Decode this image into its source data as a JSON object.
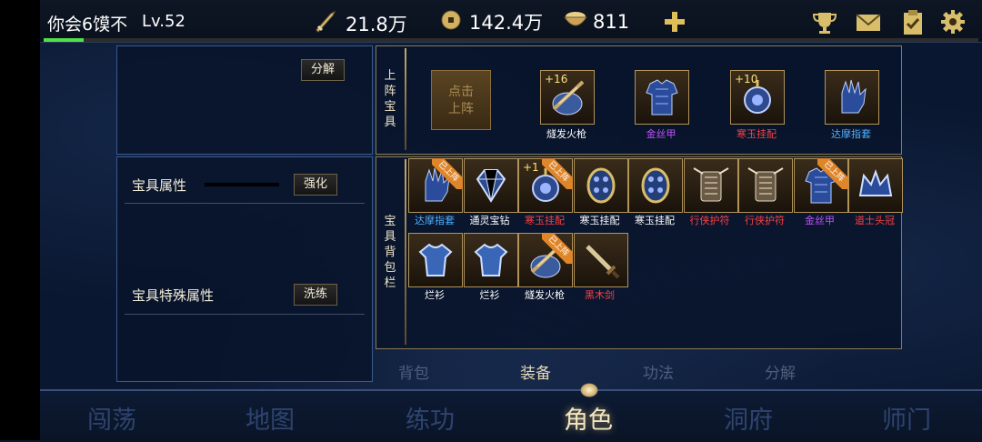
{
  "player": {
    "name": "你会6馍不",
    "level": "Lv.52"
  },
  "resources": {
    "power": "21.8万",
    "coins": "142.4万",
    "food": "811"
  },
  "colors": {
    "xp": "#4fe04a",
    "gold": "#c9a86a",
    "red_item": "#ff4040",
    "blue_item": "#4fb0ff",
    "purple_item": "#c050ff",
    "white_item": "#ffffff"
  },
  "left_top": {
    "decompose_button": "分解"
  },
  "left_bottom": {
    "attr_label": "宝具属性",
    "enhance_button": "强化",
    "special_label": "宝具特殊属性",
    "refine_button": "洗练"
  },
  "equipped": {
    "vertical_label": [
      "上",
      "阵",
      "宝",
      "具"
    ],
    "empty_slot": [
      "点击",
      "上阵"
    ],
    "items": [
      {
        "name": "燧发火枪",
        "plus": "+16",
        "color": "#ffffff",
        "icon": "musket-icon"
      },
      {
        "name": "金丝甲",
        "plus": "",
        "color": "#c050ff",
        "icon": "armor-icon"
      },
      {
        "name": "寒玉挂配",
        "plus": "+10",
        "color": "#ff4040",
        "icon": "pendant-icon"
      },
      {
        "name": "达摩指套",
        "plus": "",
        "color": "#4fb0ff",
        "icon": "glove-icon"
      }
    ]
  },
  "bag": {
    "vertical_label": [
      "宝",
      "具",
      "背",
      "包",
      "栏"
    ],
    "equipped_tag": "已上阵",
    "items": [
      {
        "name": "达摩指套",
        "color": "#4fb0ff",
        "equipped": true,
        "plus": "",
        "icon": "glove-icon"
      },
      {
        "name": "通灵宝钻",
        "color": "#ffffff",
        "equipped": false,
        "plus": "",
        "icon": "gem-icon"
      },
      {
        "name": "寒玉挂配",
        "color": "#ff4040",
        "equipped": true,
        "plus": "+1",
        "icon": "pendant-icon"
      },
      {
        "name": "寒玉挂配",
        "color": "#ffffff",
        "equipped": false,
        "plus": "",
        "icon": "jade-icon"
      },
      {
        "name": "寒玉挂配",
        "color": "#ffffff",
        "equipped": false,
        "plus": "",
        "icon": "jade-icon"
      },
      {
        "name": "行侠护符",
        "color": "#ff4040",
        "equipped": false,
        "plus": "",
        "icon": "amulet-icon"
      },
      {
        "name": "行侠护符",
        "color": "#ff4040",
        "equipped": false,
        "plus": "",
        "icon": "amulet-icon"
      },
      {
        "name": "金丝甲",
        "color": "#c050ff",
        "equipped": true,
        "plus": "",
        "icon": "armor-icon"
      },
      {
        "name": "道士头冠",
        "color": "#ff4040",
        "equipped": false,
        "plus": "",
        "icon": "crown-icon"
      },
      {
        "name": "烂衫",
        "color": "#ffffff",
        "equipped": false,
        "plus": "",
        "icon": "shirt-icon"
      },
      {
        "name": "烂衫",
        "color": "#ffffff",
        "equipped": false,
        "plus": "",
        "icon": "shirt-icon"
      },
      {
        "name": "燧发火枪",
        "color": "#ffffff",
        "equipped": true,
        "plus": "",
        "icon": "musket-icon"
      },
      {
        "name": "黑木剑",
        "color": "#ff4040",
        "equipped": false,
        "plus": "",
        "icon": "sword-icon"
      }
    ]
  },
  "sub_tabs": [
    {
      "label": "背包",
      "active": false
    },
    {
      "label": "装备",
      "active": true
    },
    {
      "label": "功法",
      "active": false
    },
    {
      "label": "分解",
      "active": false
    }
  ],
  "bottom_nav": [
    {
      "label": "闯荡",
      "active": false
    },
    {
      "label": "地图",
      "active": false
    },
    {
      "label": "练功",
      "active": false
    },
    {
      "label": "角色",
      "active": true
    },
    {
      "label": "洞府",
      "active": false
    },
    {
      "label": "师门",
      "active": false
    }
  ]
}
